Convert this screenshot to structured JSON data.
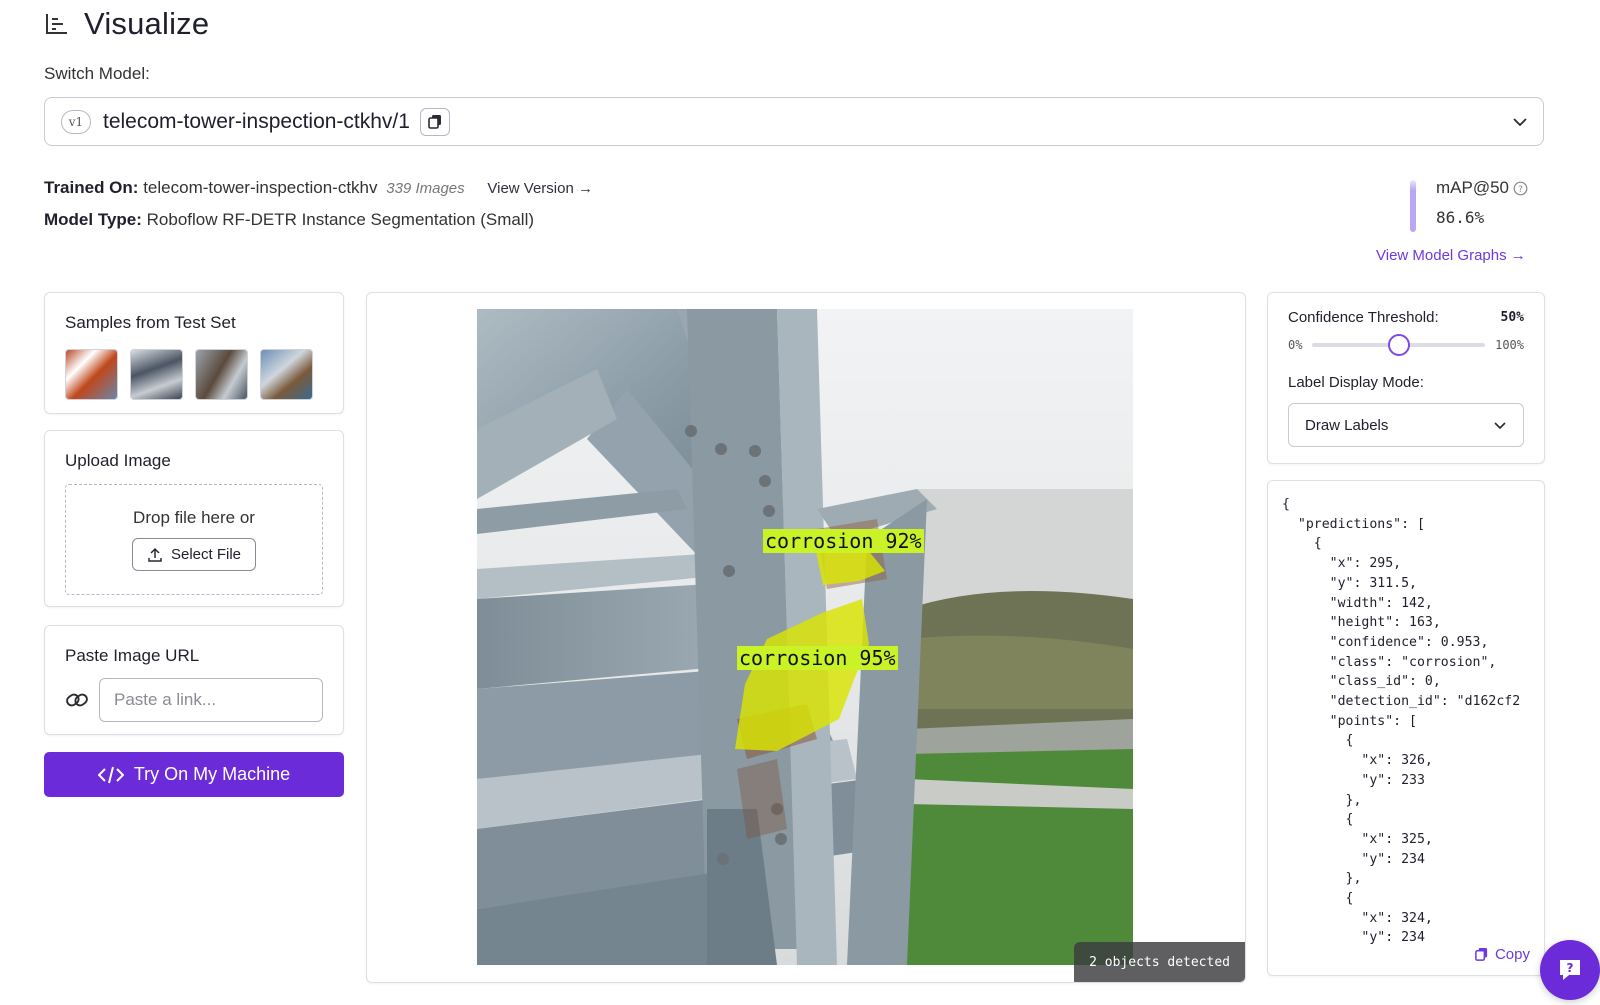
{
  "header": {
    "title": "Visualize",
    "icon": "chart-icon"
  },
  "model": {
    "switch_label": "Switch Model:",
    "version": "v1",
    "name": "telecom-tower-inspection-ctkhv/1"
  },
  "info": {
    "trained_on_label": "Trained On:",
    "trained_on_value": "telecom-tower-inspection-ctkhv",
    "images_count": "339 Images",
    "view_version": "View Version",
    "model_type_label": "Model Type:",
    "model_type_value": "Roboflow RF-DETR Instance Segmentation (Small)"
  },
  "metrics": {
    "map_label": "mAP@50",
    "map_value": "86.6%",
    "graphs_link": "View Model Graphs"
  },
  "samples": {
    "title": "Samples from Test Set",
    "count": 4
  },
  "upload": {
    "title": "Upload Image",
    "drop_text": "Drop file here or",
    "select_button": "Select File"
  },
  "url": {
    "title": "Paste Image URL",
    "placeholder": "Paste a link..."
  },
  "try_button": "Try On My Machine",
  "viewer": {
    "detections": [
      {
        "label": "corrosion 92%"
      },
      {
        "label": "corrosion 95%"
      }
    ],
    "badge": "2 objects detected"
  },
  "controls": {
    "confidence_label": "Confidence Threshold:",
    "confidence_value": "50%",
    "confidence_fraction": 0.5,
    "min_label": "0%",
    "max_label": "100%",
    "mode_label": "Label Display Mode:",
    "mode_value": "Draw Labels"
  },
  "json_output": {
    "text": "{\n  \"predictions\": [\n    {\n      \"x\": 295,\n      \"y\": 311.5,\n      \"width\": 142,\n      \"height\": 163,\n      \"confidence\": 0.953,\n      \"class\": \"corrosion\",\n      \"class_id\": 0,\n      \"detection_id\": \"d162cf2\n      \"points\": [\n        {\n          \"x\": 326,\n          \"y\": 233\n        },\n        {\n          \"x\": 325,\n          \"y\": 234\n        },\n        {\n          \"x\": 324,\n          \"y\": 234",
    "copy_label": "Copy"
  },
  "colors": {
    "accent": "#6c2bd9",
    "link": "#6c3ae0",
    "mask": "#d9e400",
    "label_bg": "#c9f227"
  }
}
